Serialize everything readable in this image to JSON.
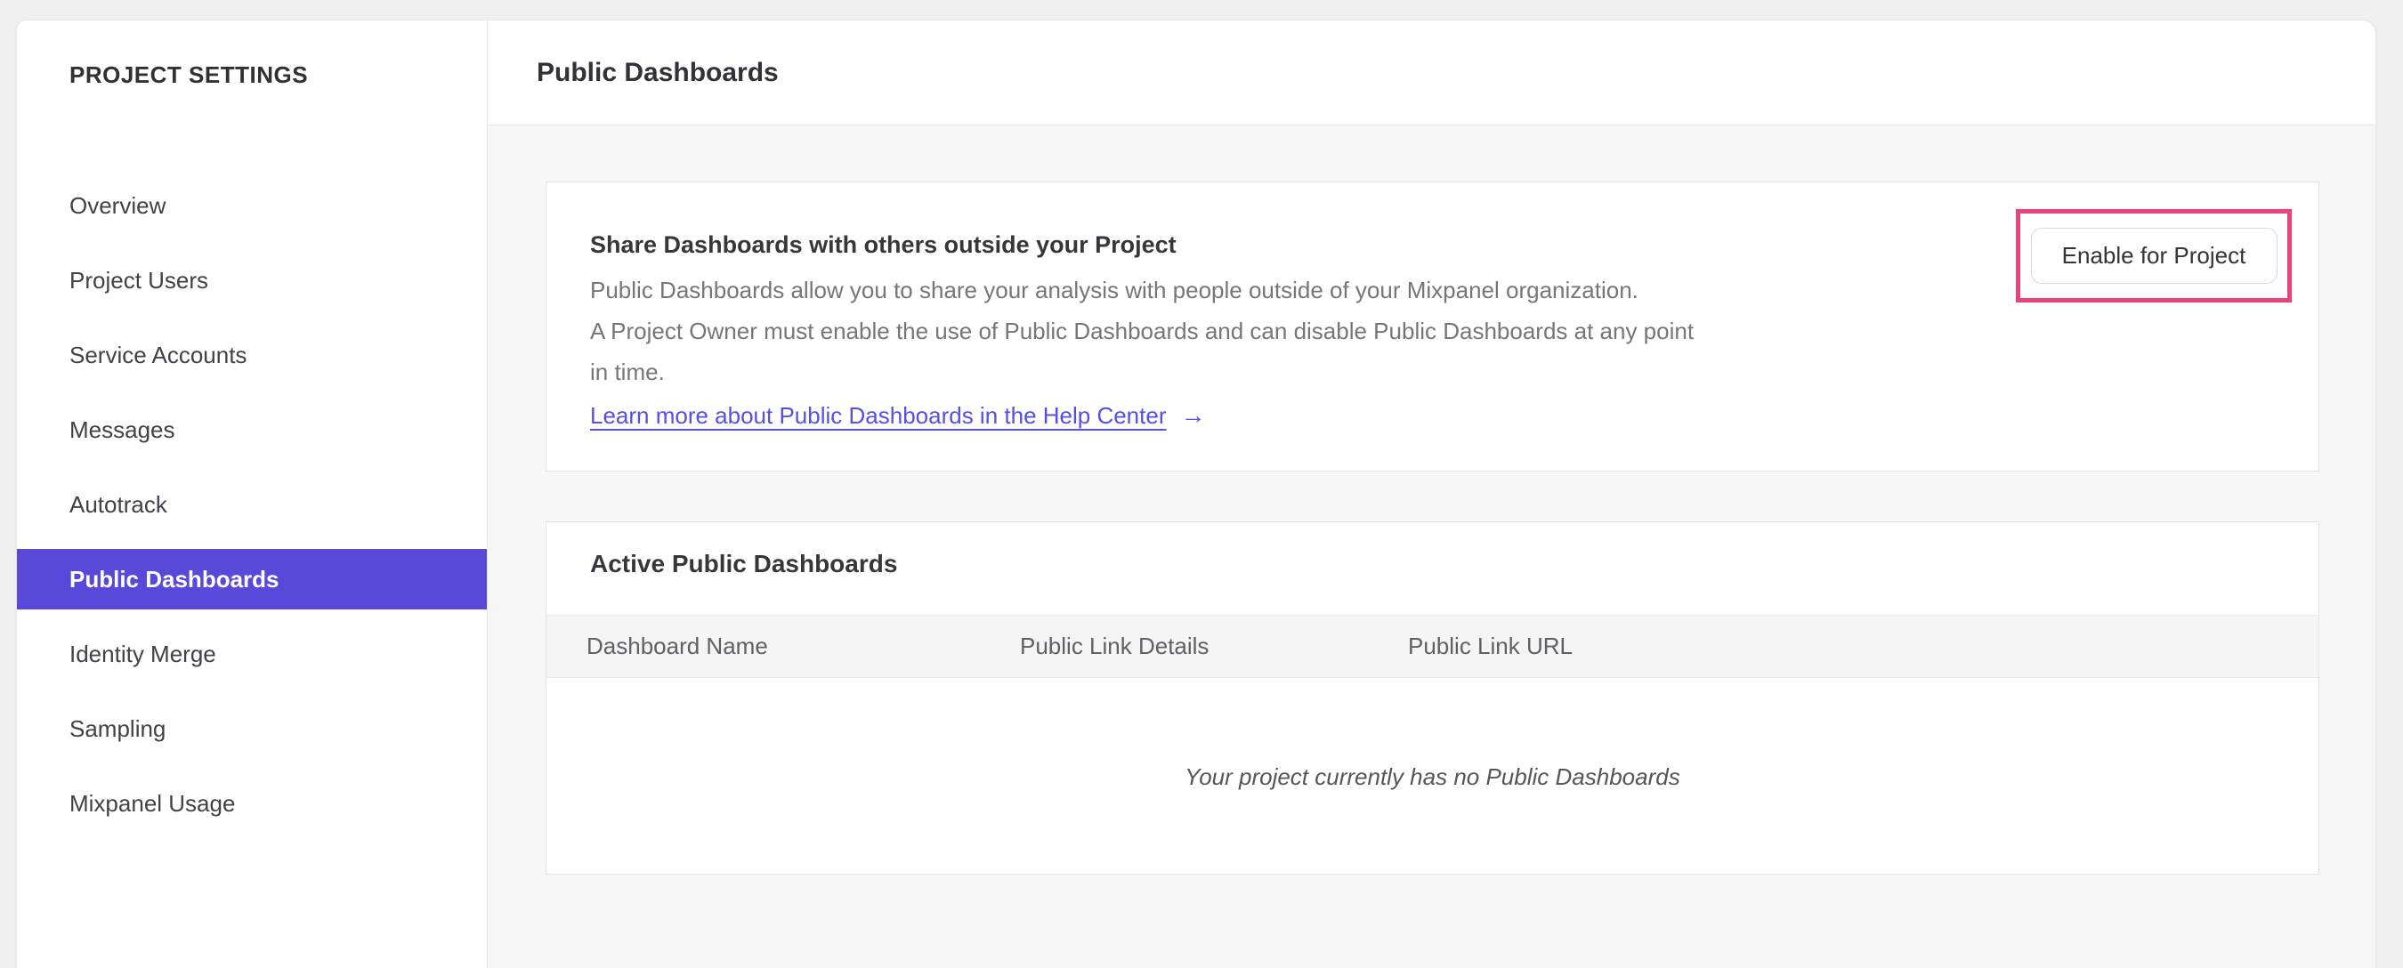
{
  "page": {
    "title": "Public Dashboards"
  },
  "sidebar": {
    "title": "PROJECT SETTINGS",
    "items": [
      {
        "label": "Overview",
        "active": false
      },
      {
        "label": "Project Users",
        "active": false
      },
      {
        "label": "Service Accounts",
        "active": false
      },
      {
        "label": "Messages",
        "active": false
      },
      {
        "label": "Autotrack",
        "active": false
      },
      {
        "label": "Public Dashboards",
        "active": true
      },
      {
        "label": "Identity Merge",
        "active": false
      },
      {
        "label": "Sampling",
        "active": false
      },
      {
        "label": "Mixpanel Usage",
        "active": false
      }
    ]
  },
  "share_card": {
    "title": "Share Dashboards with others outside your Project",
    "description_lines": [
      "Public Dashboards allow you to share your analysis with people outside of your Mixpanel organization.",
      "A Project Owner must enable the use of Public Dashboards and can disable Public Dashboards at any point",
      "in time."
    ],
    "link_label": "Learn more about Public Dashboards in the Help Center",
    "arrow_icon": "→",
    "enable_button_label": "Enable for Project"
  },
  "active_dashboards": {
    "title": "Active Public Dashboards",
    "columns": [
      "Dashboard Name",
      "Public Link Details",
      "Public Link URL"
    ],
    "rows": [],
    "empty_message": "Your project currently has no Public Dashboards"
  },
  "colors": {
    "accent_purple": "#5949db",
    "annotation_pink": "#e8437f",
    "link_indigo": "#574fe0"
  }
}
